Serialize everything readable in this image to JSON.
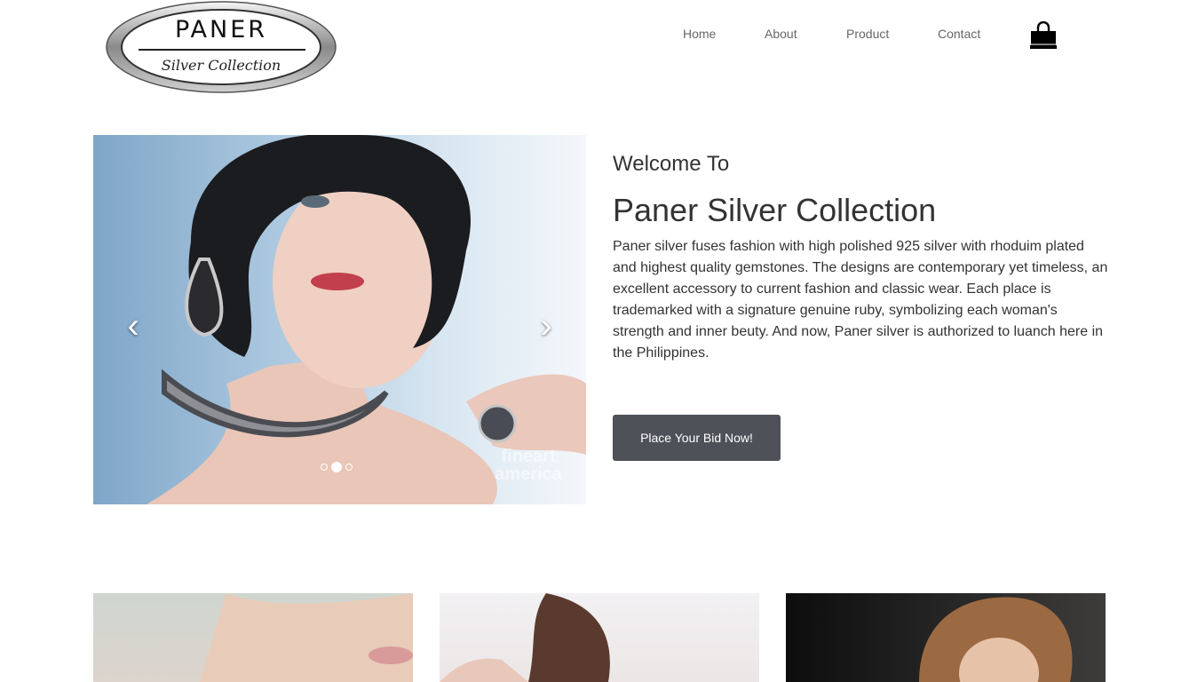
{
  "logo": {
    "title": "PANER",
    "subtitle": "Silver Collection"
  },
  "nav": {
    "items": [
      {
        "label": "Home"
      },
      {
        "label": "About"
      },
      {
        "label": "Product"
      },
      {
        "label": "Contact"
      }
    ],
    "cart_icon": "shopping-bag-icon"
  },
  "carousel": {
    "slide_count": 3,
    "active_slide": 2,
    "prev_icon": "chevron-left-icon",
    "next_icon": "chevron-right-icon",
    "watermark": "fineart america"
  },
  "intro": {
    "welcome": "Welcome To",
    "heading": "Paner Silver Collection",
    "description": "Paner silver fuses fashion with high polished 925 silver with rhoduim plated and highest quality gemstones. The designs are contemporary yet timeless, an excellent accessory to current fashion and classic wear. Each place is trademarked with a signature genuine ruby, symbolizing each woman's strength and inner beuty. And now, Paner silver is authorized to luanch here in the Philippines.",
    "cta_label": "Place Your Bid Now!"
  },
  "colors": {
    "button_bg": "#4f5159",
    "text": "#333333",
    "nav_text": "#666666"
  }
}
